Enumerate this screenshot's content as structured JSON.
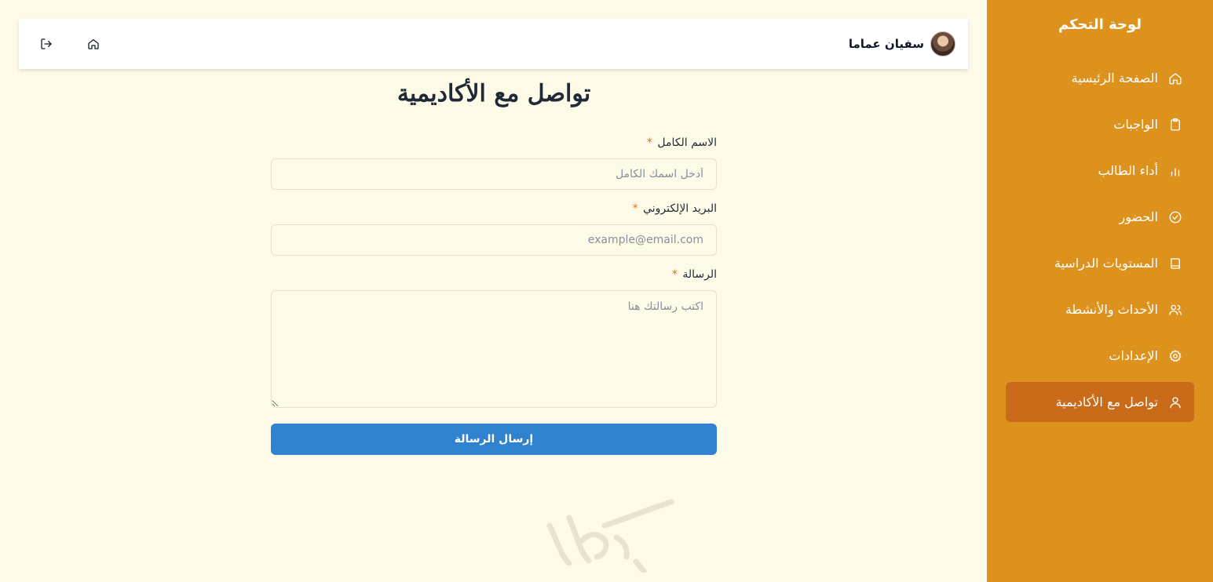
{
  "sidebar": {
    "title": "لوحة التحكم",
    "items": [
      {
        "label": "الصفحة الرئيسية",
        "icon": "home-icon",
        "active": false
      },
      {
        "label": "الواجبات",
        "icon": "clipboard-icon",
        "active": false
      },
      {
        "label": "أداء الطالب",
        "icon": "bar-chart-icon",
        "active": false
      },
      {
        "label": "الحضور",
        "icon": "check-circle-icon",
        "active": false
      },
      {
        "label": "المستويات الدراسية",
        "icon": "book-icon",
        "active": false
      },
      {
        "label": "الأحداث والأنشطة",
        "icon": "users-icon",
        "active": false
      },
      {
        "label": "الإعدادات",
        "icon": "gear-icon",
        "active": false
      },
      {
        "label": "تواصل مع الأكاديمية",
        "icon": "user-icon",
        "active": true
      }
    ],
    "colors": {
      "background": "#de921e",
      "active": "#c96b18"
    }
  },
  "header": {
    "user_name": "سفيان عماما",
    "actions": [
      "home-icon",
      "logout-icon"
    ]
  },
  "main": {
    "title": "تواصل مع الأكاديمية",
    "form": {
      "name_label": "الاسم الكامل",
      "name_placeholder": "أدخل اسمك الكامل",
      "email_label": "البريد الإلكتروني",
      "email_placeholder": "example@email.com",
      "message_label": "الرسالة",
      "message_placeholder": "اكتب رسالتك هنا",
      "required_mark": "*",
      "submit_label": "إرسال الرسالة"
    },
    "colors": {
      "submit": "#3182ce",
      "page_background": "#fefae8"
    }
  },
  "watermark": {
    "icon": "signature-logo"
  }
}
